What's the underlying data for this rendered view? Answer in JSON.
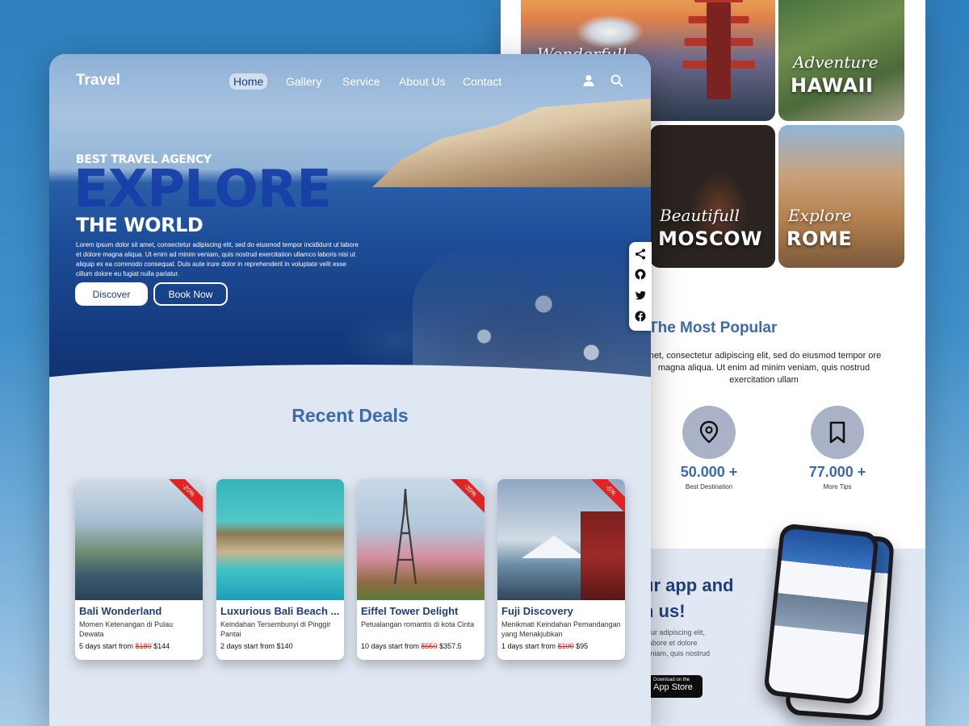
{
  "back_page": {
    "gallery": [
      {
        "script": "Wonderfull",
        "caption": ""
      },
      {
        "script": "Adventure",
        "caption": "HAWAII"
      },
      {
        "script": "Beautifull",
        "caption": "MOSCOW"
      },
      {
        "script": "Explore",
        "caption": "ROME"
      }
    ],
    "popular_title": "The Most Popular",
    "popular_text": "met, consectetur adipiscing elit, sed do eiusmod tempor ore magna aliqua. Ut enim ad minim veniam, quis nostrud exercitation ullam",
    "stats": [
      {
        "value": "50.000 +",
        "label": "Best Destination",
        "icon": "location-pin-icon"
      },
      {
        "value": "77.000 +",
        "label": "More Tips",
        "icon": "bookmark-icon"
      }
    ],
    "app_heading": "ur app and\nh us!",
    "app_text": "tetur adipiscing elit,\nt labore et dolore\nveniam, quis nostrud",
    "store_small": "Download on the",
    "store_big": "App Store"
  },
  "main_page": {
    "logo": "Travel",
    "nav": [
      "Home",
      "Gallery",
      "Service",
      "About Us",
      "Contact"
    ],
    "active_nav": "Home",
    "hero": {
      "kicker": "BEST TRAVEL AGENCY",
      "title": "EXPLORE",
      "subtitle": "THE WORLD",
      "description": "Lorem ipsum dolor sit amet, consectetur adipiscing elit, sed do eiusmod tempor incididunt ut labore et dolore magna aliqua. Ut enim ad minim veniam, quis nostrud exercitation ullamco laboris nisi ut aliquip ex ea commodo consequat. Duis aute irure dolor in reprehenderit in voluptate velit esse cillum dolore eu fugiat nulla pariatur.",
      "btn_discover": "Discover",
      "btn_book": "Book Now"
    },
    "section_title": "Recent Deals",
    "deals": [
      {
        "title": "Bali Wonderland",
        "desc": "Momen Ketenangan di Pulau Dewata",
        "price_prefix": "5 days start from",
        "old_price": "$180",
        "new_price": "$144",
        "badge": "-20%"
      },
      {
        "title": "Luxurious Bali Beach ...",
        "desc": "Keindahan Tersembunyi di Pinggir Pantai",
        "price_prefix": "2 days start from",
        "old_price": "",
        "new_price": "$140",
        "badge": ""
      },
      {
        "title": "Eiffel Tower Delight",
        "desc": "Petualangan romantis di kota Cinta",
        "price_prefix": "10 days start from",
        "old_price": "$550",
        "new_price": "$357.5",
        "badge": "-35%"
      },
      {
        "title": "Fuji Discovery",
        "desc": "Menikmati Keindahan Pemandangan yang Menakjubkan",
        "price_prefix": "1 days start from",
        "old_price": "$100",
        "new_price": "$95",
        "badge": "-5%"
      }
    ]
  },
  "colors": {
    "accent": "#3c6aaa",
    "dark_blue": "#1d3f78",
    "sale_red": "#e02424",
    "page_bg": "#dfe7f3"
  }
}
